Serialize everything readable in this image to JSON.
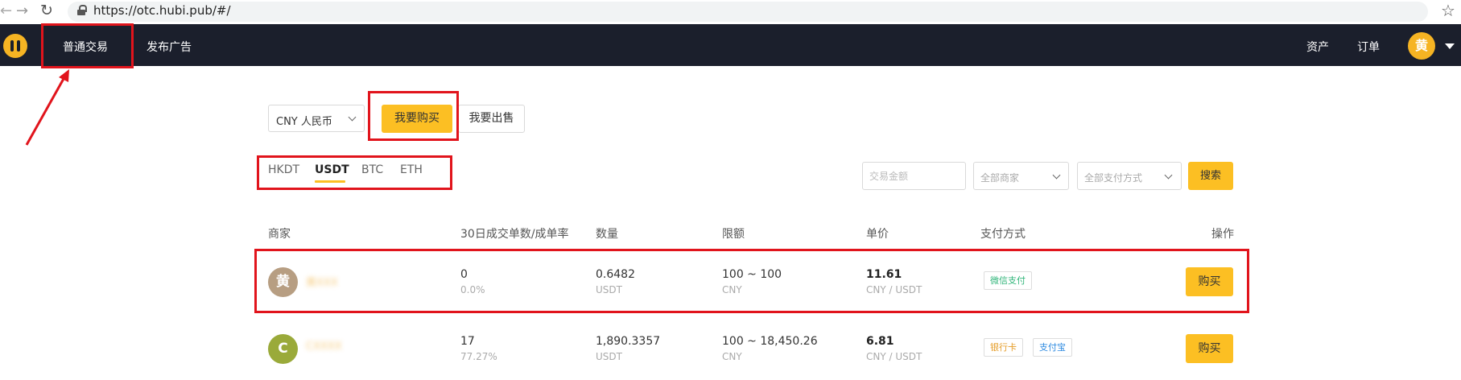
{
  "browser": {
    "back_glyph": "←",
    "forward_glyph": "→",
    "reload_glyph": "↻",
    "url": "https://otc.hubi.pub/#/",
    "bookmark_glyph": "☆"
  },
  "topnav": {
    "logo_icon": "hubi-logo-icon",
    "items": [
      {
        "label": "普通交易"
      },
      {
        "label": "发布广告"
      }
    ],
    "assets_label": "资产",
    "orders_label": "订单",
    "user_avatar_text": "黄"
  },
  "controls": {
    "currency_select": "CNY 人民币",
    "buy_label": "我要购买",
    "sell_label": "我要出售"
  },
  "coin_tabs": [
    {
      "label": "HKDT",
      "active": false
    },
    {
      "label": "USDT",
      "active": true
    },
    {
      "label": "BTC",
      "active": false
    },
    {
      "label": "ETH",
      "active": false
    }
  ],
  "filters": {
    "amount_placeholder": "交易金额",
    "merchant_select": "全部商家",
    "payment_select": "全部支付方式",
    "search_label": "搜索"
  },
  "table": {
    "headers": [
      "商家",
      "30日成交单数/成单率",
      "数量",
      "限额",
      "单价",
      "支付方式",
      "操作"
    ],
    "rows": [
      {
        "avatar_text": "黄",
        "avatar_color": "#b79e82",
        "merchant": "黄XXX",
        "orders": "0",
        "rate": "0.0%",
        "quantity": "0.6482",
        "quantity_unit": "USDT",
        "limit": "100 ~ 100",
        "limit_unit": "CNY",
        "price": "11.61",
        "price_unit": "CNY / USDT",
        "payments": [
          "微信支付"
        ],
        "action": "购买"
      },
      {
        "avatar_text": "C",
        "avatar_color": "#9aaa3a",
        "merchant": "CXXXX",
        "orders": "17",
        "rate": "77.27%",
        "quantity": "1,890.3357",
        "quantity_unit": "USDT",
        "limit": "100 ~ 18,450.26",
        "limit_unit": "CNY",
        "price": "6.81",
        "price_unit": "CNY / USDT",
        "payments": [
          "银行卡",
          "支付宝"
        ],
        "action": "购买"
      }
    ]
  },
  "colors": {
    "accent": "#fcbf23",
    "nav_bg": "#1b1f2c",
    "annotation_red": "#e1141c"
  }
}
